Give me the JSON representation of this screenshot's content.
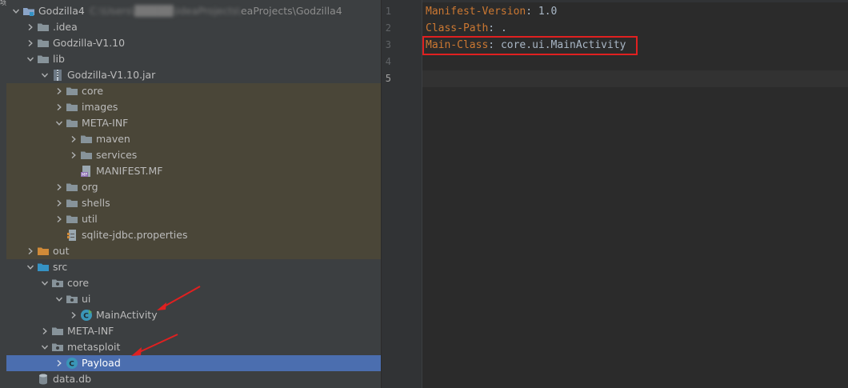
{
  "tree": {
    "root": {
      "label": "Godzilla4",
      "path_obscured": "C:\\Users\\█████\\IdeaProjects\\",
      "path_tail": "eaProjects\\Godzilla4"
    },
    "items": [
      {
        "label": ".idea"
      },
      {
        "label": "Godzilla-V1.10"
      },
      {
        "label": "lib"
      },
      {
        "label": "Godzilla-V1.10.jar"
      },
      {
        "label": "core"
      },
      {
        "label": "images"
      },
      {
        "label": "META-INF"
      },
      {
        "label": "maven"
      },
      {
        "label": "services"
      },
      {
        "label": "MANIFEST.MF"
      },
      {
        "label": "org"
      },
      {
        "label": "shells"
      },
      {
        "label": "util"
      },
      {
        "label": "sqlite-jdbc.properties"
      },
      {
        "label": "out"
      },
      {
        "label": "src"
      },
      {
        "label": "core"
      },
      {
        "label": "ui"
      },
      {
        "label": "MainActivity"
      },
      {
        "label": "META-INF"
      },
      {
        "label": "metasploit"
      },
      {
        "label": "Payload"
      },
      {
        "label": "data.db"
      }
    ]
  },
  "editor": {
    "line_numbers": [
      "1",
      "2",
      "3",
      "4",
      "5"
    ],
    "lines": [
      {
        "key": "Manifest-Version",
        "sep": ": ",
        "value": "1.0"
      },
      {
        "key": "Class-Path",
        "sep": ": ",
        "value": "."
      },
      {
        "key": "Main-Class",
        "sep": ": ",
        "value": "core.ui.MainActivity"
      },
      {
        "key": "",
        "sep": "",
        "value": ""
      },
      {
        "key": "",
        "sep": "",
        "value": ""
      }
    ]
  },
  "colors": {
    "panel_bg": "#3c3f41",
    "jar_highlight_bg": "#4a4638",
    "selection_bg": "#4b6eaf",
    "editor_bg": "#2b2b2b",
    "manifest_key": "#cc7832",
    "manifest_value": "#a9b7c6",
    "annotation_red": "#e02020"
  },
  "left_strip_glyph": "项"
}
